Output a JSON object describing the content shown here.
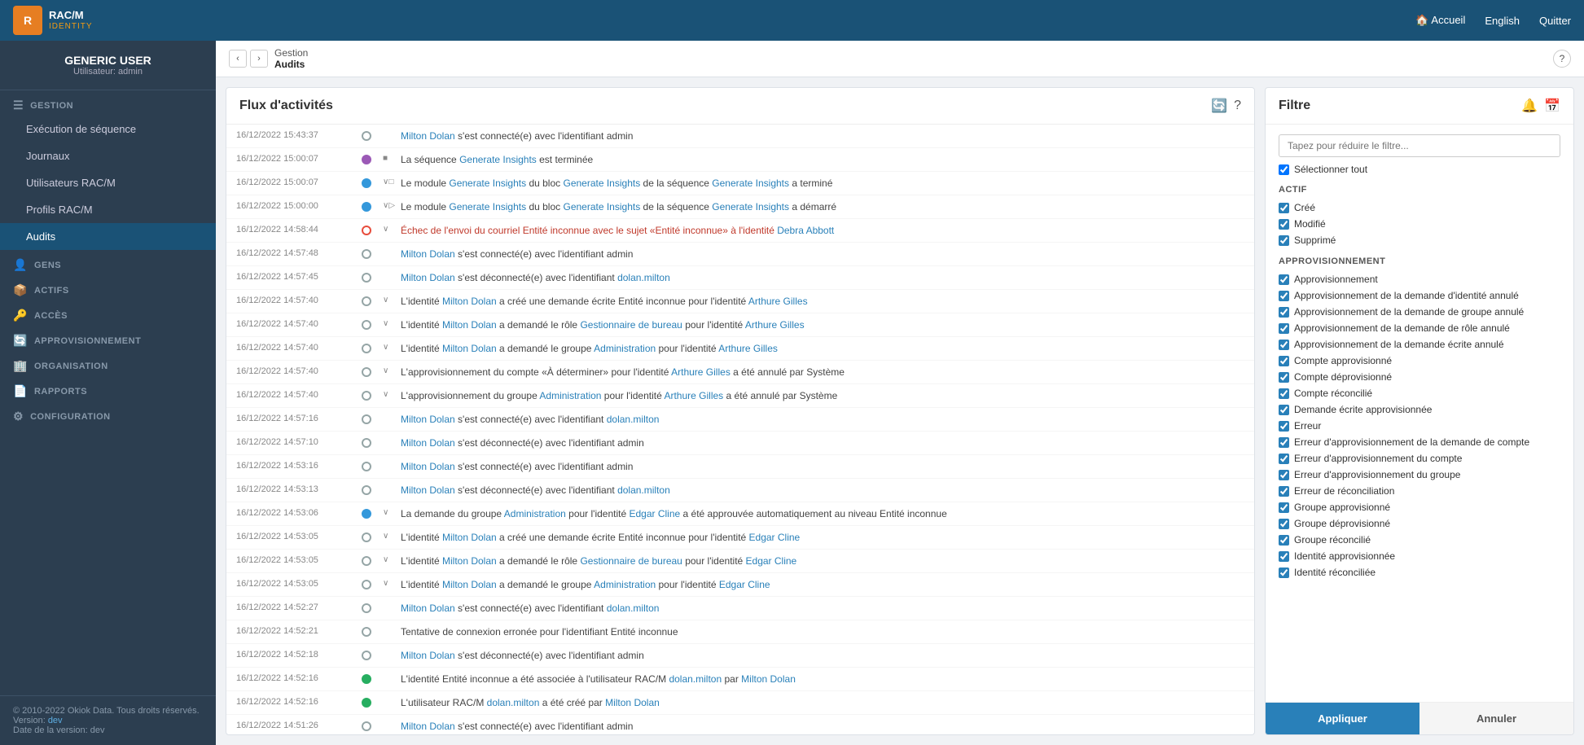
{
  "app": {
    "logo_text": "RAC/M",
    "logo_sub": "IDENTITY",
    "nav_links": [
      {
        "label": "🏠 Accueil",
        "name": "accueil-link"
      },
      {
        "label": "English",
        "name": "language-link"
      },
      {
        "label": "Quitter",
        "name": "quit-link"
      }
    ]
  },
  "sidebar": {
    "user_name": "GENERIC USER",
    "user_role": "Utilisateur: admin",
    "sections": [
      {
        "label": "GESTION",
        "name": "gestion-section",
        "items": [
          {
            "label": "Exécution de séquence",
            "name": "execution-item"
          },
          {
            "label": "Journaux",
            "name": "journaux-item"
          },
          {
            "label": "Utilisateurs RAC/M",
            "name": "utilisateurs-item"
          },
          {
            "label": "Profils RAC/M",
            "name": "profils-item"
          },
          {
            "label": "Audits",
            "name": "audits-item",
            "active": true
          }
        ]
      },
      {
        "label": "GENS",
        "name": "gens-section",
        "items": []
      },
      {
        "label": "ACTIFS",
        "name": "actifs-section",
        "items": []
      },
      {
        "label": "ACCÈS",
        "name": "acces-section",
        "items": []
      },
      {
        "label": "APPROVISIONNEMENT",
        "name": "approvisionnement-section",
        "items": []
      },
      {
        "label": "ORGANISATION",
        "name": "organisation-section",
        "items": []
      },
      {
        "label": "RAPPORTS",
        "name": "rapports-section",
        "items": []
      },
      {
        "label": "CONFIGURATION",
        "name": "configuration-section",
        "items": []
      }
    ],
    "footer": {
      "copyright": "© 2010-2022 Okiok Data. Tous droits réservés.",
      "version_label": "Version:",
      "version_value": "dev",
      "date_label": "Date de la version:",
      "date_value": "dev"
    }
  },
  "breadcrumb": {
    "parent": "Gestion",
    "current": "Audits"
  },
  "activity": {
    "title": "Flux d'activités",
    "items": [
      {
        "time": "16/12/2022 15:43:37",
        "dot": "gray",
        "expand": "",
        "text": "Milton Dolan s'est connecté(e) avec l'identifiant admin"
      },
      {
        "time": "16/12/2022 15:00:07",
        "dot": "purple",
        "expand": "■",
        "text": "La séquence Generate Insights est terminée"
      },
      {
        "time": "16/12/2022 15:00:07",
        "dot": "blue",
        "expand": "∨□",
        "text": "Le module Generate Insights du bloc Generate Insights de la séquence Generate Insights a terminé"
      },
      {
        "time": "16/12/2022 15:00:00",
        "dot": "blue",
        "expand": "∨▷",
        "text": "Le module Generate Insights du bloc Generate Insights de la séquence Generate Insights a démarré"
      },
      {
        "time": "16/12/2022 14:58:44",
        "dot": "red",
        "expand": "∨",
        "text": "Échec de l'envoi du courriel Entité inconnue avec le sujet «Entité inconnue» à l'identité Debra Abbott",
        "highlight_red": true
      },
      {
        "time": "16/12/2022 14:57:48",
        "dot": "gray",
        "expand": "",
        "text": "Milton Dolan s'est connecté(e) avec l'identifiant admin"
      },
      {
        "time": "16/12/2022 14:57:45",
        "dot": "gray",
        "expand": "",
        "text": "Milton Dolan s'est déconnecté(e) avec l'identifiant dolan.milton"
      },
      {
        "time": "16/12/2022 14:57:40",
        "dot": "gray",
        "expand": "∨",
        "text": "L'identité Milton Dolan a créé une demande écrite Entité inconnue pour l'identité Arthure Gilles"
      },
      {
        "time": "16/12/2022 14:57:40",
        "dot": "gray",
        "expand": "∨",
        "text": "L'identité Milton Dolan a demandé le rôle Gestionnaire de bureau pour l'identité Arthure Gilles"
      },
      {
        "time": "16/12/2022 14:57:40",
        "dot": "gray",
        "expand": "∨",
        "text": "L'identité Milton Dolan a demandé le groupe Administration pour l'identité Arthure Gilles"
      },
      {
        "time": "16/12/2022 14:57:40",
        "dot": "gray",
        "expand": "∨",
        "text": "L'approvisionnement du compte «À déterminer» pour l'identité Arthure Gilles a été annulé par Système"
      },
      {
        "time": "16/12/2022 14:57:40",
        "dot": "gray",
        "expand": "∨",
        "text": "L'approvisionnement du groupe Administration pour l'identité Arthure Gilles a été annulé par Système"
      },
      {
        "time": "16/12/2022 14:57:16",
        "dot": "gray",
        "expand": "",
        "text": "Milton Dolan s'est connecté(e) avec l'identifiant dolan.milton"
      },
      {
        "time": "16/12/2022 14:57:10",
        "dot": "gray",
        "expand": "",
        "text": "Milton Dolan s'est déconnecté(e) avec l'identifiant admin"
      },
      {
        "time": "16/12/2022 14:53:16",
        "dot": "gray",
        "expand": "",
        "text": "Milton Dolan s'est connecté(e) avec l'identifiant admin"
      },
      {
        "time": "16/12/2022 14:53:13",
        "dot": "gray",
        "expand": "",
        "text": "Milton Dolan s'est déconnecté(e) avec l'identifiant dolan.milton"
      },
      {
        "time": "16/12/2022 14:53:06",
        "dot": "blue",
        "expand": "∨",
        "text": "La demande du groupe Administration pour l'identité Edgar Cline a été approuvée automatiquement au niveau Entité inconnue"
      },
      {
        "time": "16/12/2022 14:53:05",
        "dot": "gray",
        "expand": "∨",
        "text": "L'identité Milton Dolan a créé une demande écrite Entité inconnue pour l'identité Edgar Cline"
      },
      {
        "time": "16/12/2022 14:53:05",
        "dot": "gray",
        "expand": "∨",
        "text": "L'identité Milton Dolan a demandé le rôle Gestionnaire de bureau pour l'identité Edgar Cline"
      },
      {
        "time": "16/12/2022 14:53:05",
        "dot": "gray",
        "expand": "∨",
        "text": "L'identité Milton Dolan a demandé le groupe Administration pour l'identité Edgar Cline"
      },
      {
        "time": "16/12/2022 14:52:27",
        "dot": "gray",
        "expand": "",
        "text": "Milton Dolan s'est connecté(e) avec l'identifiant dolan.milton"
      },
      {
        "time": "16/12/2022 14:52:21",
        "dot": "gray",
        "expand": "",
        "text": "Tentative de connexion erronée pour l'identifiant Entité inconnue"
      },
      {
        "time": "16/12/2022 14:52:18",
        "dot": "gray",
        "expand": "",
        "text": "Milton Dolan s'est déconnecté(e) avec l'identifiant admin"
      },
      {
        "time": "16/12/2022 14:52:16",
        "dot": "green",
        "expand": "",
        "text": "L'identité Entité inconnue a été associée à l'utilisateur RAC/M dolan.milton par Milton Dolan"
      },
      {
        "time": "16/12/2022 14:52:16",
        "dot": "green",
        "expand": "",
        "text": "L'utilisateur RAC/M dolan.milton a été créé par Milton Dolan"
      },
      {
        "time": "16/12/2022 14:51:26",
        "dot": "gray",
        "expand": "",
        "text": "Milton Dolan s'est connecté(e) avec l'identifiant admin"
      }
    ]
  },
  "filter": {
    "title": "Filtre",
    "search_placeholder": "Tapez pour réduire le filtre...",
    "select_all_label": "Sélectionner tout",
    "sections": [
      {
        "title": "ACTIF",
        "items": [
          {
            "label": "Créé",
            "checked": true
          },
          {
            "label": "Modifié",
            "checked": true
          },
          {
            "label": "Supprimé",
            "checked": true
          }
        ]
      },
      {
        "title": "APPROVISIONNEMENT",
        "items": [
          {
            "label": "Approvisionnement",
            "checked": true
          },
          {
            "label": "Approvisionnement de la demande d'identité annulé",
            "checked": true
          },
          {
            "label": "Approvisionnement de la demande de groupe annulé",
            "checked": true
          },
          {
            "label": "Approvisionnement de la demande de rôle annulé",
            "checked": true
          },
          {
            "label": "Approvisionnement de la demande écrite annulé",
            "checked": true
          },
          {
            "label": "Compte approvisionné",
            "checked": true
          },
          {
            "label": "Compte déprovisionné",
            "checked": true
          },
          {
            "label": "Compte réconcilié",
            "checked": true
          },
          {
            "label": "Demande écrite approvisionnée",
            "checked": true
          },
          {
            "label": "Erreur",
            "checked": true
          },
          {
            "label": "Erreur d'approvisionnement de la demande de compte",
            "checked": true
          },
          {
            "label": "Erreur d'approvisionnement du compte",
            "checked": true
          },
          {
            "label": "Erreur d'approvisionnement du groupe",
            "checked": true
          },
          {
            "label": "Erreur de réconciliation",
            "checked": true
          },
          {
            "label": "Groupe approvisionné",
            "checked": true
          },
          {
            "label": "Groupe déprovisionné",
            "checked": true
          },
          {
            "label": "Groupe réconcilié",
            "checked": true
          },
          {
            "label": "Identité approvisionnée",
            "checked": true
          },
          {
            "label": "Identité réconciliée",
            "checked": true
          }
        ]
      }
    ],
    "apply_label": "Appliquer",
    "cancel_label": "Annuler"
  }
}
